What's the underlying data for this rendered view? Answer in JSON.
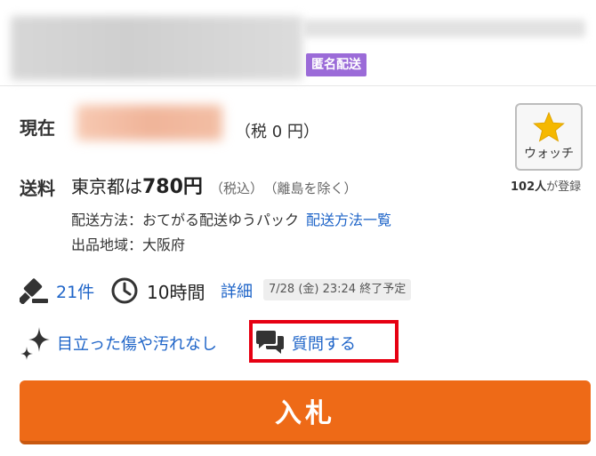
{
  "listing": {
    "anonymous_shipping_badge": "匿名配送"
  },
  "price": {
    "label": "現在",
    "tax_note": "（税 0 円）"
  },
  "watch": {
    "button_label": "ウォッチ",
    "count_number": "102人",
    "count_suffix": "が登録",
    "accent_color": "#f5b800"
  },
  "shipping": {
    "label": "送料",
    "prefix": "東京都は",
    "price": "780円",
    "tax_included": "（税込）",
    "note": "（離島を除く）",
    "method_label": "配送方法：おてがる配送ゆうパック",
    "method_link": "配送方法一覧",
    "origin": "出品地域：大阪府"
  },
  "auction": {
    "bid_count": "21件",
    "remaining": "10時間",
    "detail_link": "詳細",
    "end_time": "7/28 (金) 23:24 終了予定"
  },
  "condition": {
    "text": "目立った傷や汚れなし"
  },
  "question": {
    "label": "質問する"
  },
  "bid_button": {
    "label": "入札",
    "color": "#ee6a17"
  },
  "colors": {
    "link": "#1e64c8",
    "badge": "#9b6bd8",
    "highlight_border": "#e60012"
  }
}
